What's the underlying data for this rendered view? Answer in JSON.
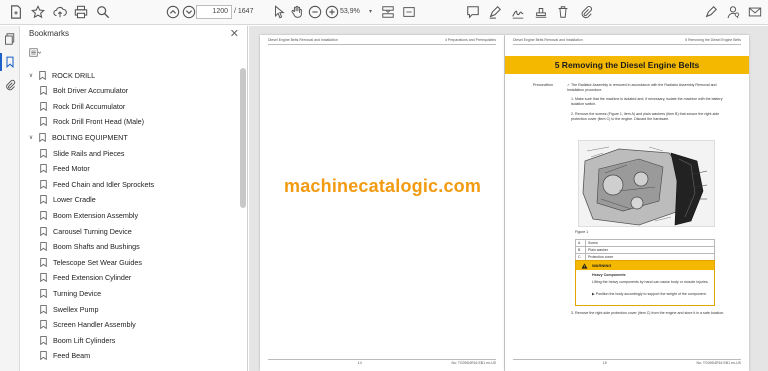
{
  "toolbar": {
    "page_current": "1200",
    "page_total": "/ 1647",
    "zoom": "53,9%",
    "zoom_caret": "▾"
  },
  "bookmarks": {
    "title": "Bookmarks",
    "close_glyph": "✕",
    "items": [
      {
        "label": "ROCK DRILL",
        "level": 0,
        "expanded": true
      },
      {
        "label": "Bolt Driver Accumulator",
        "level": 1
      },
      {
        "label": " Rock Drill Accumulator",
        "level": 1
      },
      {
        "label": "Rock Drill Front Head (Male)",
        "level": 1
      },
      {
        "label": "BOLTING EQUIPMENT",
        "level": 0,
        "expanded": true
      },
      {
        "label": "Slide Rails and Pieces",
        "level": 1
      },
      {
        "label": "Feed Motor",
        "level": 1
      },
      {
        "label": "Feed Chain and Idler Sprockets",
        "level": 1
      },
      {
        "label": "Lower Cradle",
        "level": 1
      },
      {
        "label": " Boom Extension Assembly",
        "level": 1
      },
      {
        "label": "Carousel Turning Device",
        "level": 1
      },
      {
        "label": "Boom Shafts and Bushings",
        "level": 1
      },
      {
        "label": "Telescope Set Wear Guides",
        "level": 1
      },
      {
        "label": "Feed Extension Cylinder",
        "level": 1
      },
      {
        "label": "Turning Device",
        "level": 1
      },
      {
        "label": "Swellex Pump",
        "level": 1
      },
      {
        "label": " Screen Handler Assembly",
        "level": 1
      },
      {
        "label": "Boom Lift Cylinders",
        "level": 1
      },
      {
        "label": "Feed Beam",
        "level": 1
      }
    ]
  },
  "document": {
    "left_page": {
      "header_left": "Diesel Engine Belts Removal and Installation",
      "header_right": "4 Preparations and Prerequisites",
      "footer_left": "14",
      "footer_right": "No: TG09D4R16 EB1 en-US"
    },
    "right_page": {
      "header_left": "Diesel Engine Belts Removal and Installation",
      "header_right": "5 Removing the Diesel Engine Belts",
      "section_title": "5 Removing the Diesel Engine Belts",
      "precondition_label": "Precondition",
      "precondition_text": "✓ The Radiator Assembly is removed in accordance with the Radiator Assembly Removal and Installation procedure.",
      "steps": [
        "1. Make sure that the machine is isolated and, if necessary, isolate the machine with the battery isolation switch.",
        "2. Remove the screws (Figure 1, item A) and plain washers (item B) that secure the right-side protection cover (item C) to the engine. Discard the hardware."
      ],
      "figure_caption": "Figure 1",
      "legend": [
        {
          "key": "A",
          "value": "Screw"
        },
        {
          "key": "B",
          "value": "Plain washer"
        },
        {
          "key": "C",
          "value": "Protection cover"
        }
      ],
      "warning_title": "WARNING",
      "warning_heading": "Heavy Components",
      "warning_text_1": "Lifting the heavy components by hand can cause body or muscle injuries.",
      "warning_text_2": "▶ Position the body accordingly to support the weight of the component.",
      "step_3": "3. Remove the right-side protection cover (item C) from the engine and store it in a safe location.",
      "footer_left": "15",
      "footer_right": "No: TG09D4R16 EB1 en-US"
    },
    "watermark": "machinecatalogic.com"
  },
  "colors": {
    "accent_yellow": "#f5b800",
    "watermark_orange": "#f29b11",
    "active_blue": "#1a62c8"
  }
}
